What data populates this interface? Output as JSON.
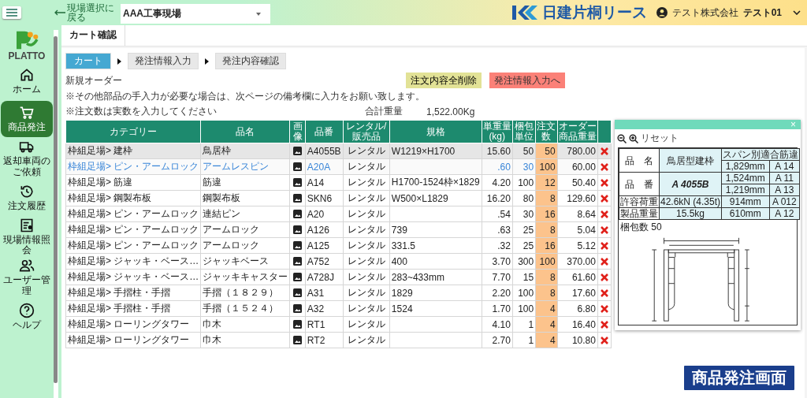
{
  "header": {
    "back_link": "現場選択に戻る",
    "site_select": {
      "value": "AAA工事現場"
    },
    "brand": "日建片桐リース",
    "company": "テスト株式会社",
    "user": "テスト01"
  },
  "sidebar": {
    "logo": "PLATTO",
    "items": [
      {
        "label": "ホーム",
        "selected": false
      },
      {
        "label": "商品発注",
        "selected": true
      },
      {
        "label": "返却車両のご依頼",
        "selected": false
      },
      {
        "label": "注文履歴",
        "selected": false
      },
      {
        "label": "現場情報照会",
        "selected": false
      },
      {
        "label": "ユーザー管理",
        "selected": false
      },
      {
        "label": "ヘルプ",
        "selected": false
      }
    ]
  },
  "page_tab": "カート確認",
  "steps": [
    {
      "label": "カート",
      "selected": true
    },
    {
      "label": "発注情報入力",
      "selected": false
    },
    {
      "label": "発注内容確認",
      "selected": false
    }
  ],
  "order_type": "新規オーダー",
  "buttons": [
    {
      "label": "注文内容全削除",
      "kind": "clear"
    },
    {
      "label": "発注情報入力へ",
      "kind": "next"
    }
  ],
  "notes": [
    "※その他部品の手入力が必要な場合は、次ページの備考欄に入力をお願い致します。",
    "※注文数は実数を入力してください"
  ],
  "total_weight": {
    "label": "合計重量",
    "value": "1,522.00Kg"
  },
  "table": {
    "columns": [
      "カテゴリー",
      "品名",
      "画像",
      "品番",
      "レンタル/販売品",
      "規格",
      "単重量(kg)",
      "梱包単位",
      "注文数",
      "オーダー商品重量"
    ],
    "rows": [
      {
        "selected": true,
        "hover": false,
        "cells": [
          "枠組足場> 建枠",
          "鳥居枠",
          "",
          "A4055B",
          "レンタル",
          "W1219×H1700",
          "15.60",
          "50",
          "50",
          "780.00"
        ]
      },
      {
        "selected": false,
        "hover": true,
        "cells": [
          "枠組足場> ピン・アームロック",
          "アームレスピン",
          "",
          "A20A",
          "レンタル",
          "",
          ".60",
          "30",
          "100",
          "60.00"
        ]
      },
      {
        "selected": false,
        "hover": false,
        "cells": [
          "枠組足場> 筋違",
          "筋違",
          "",
          "A14",
          "レンタル",
          "H1700-1524枠×1829",
          "4.20",
          "100",
          "12",
          "50.40"
        ]
      },
      {
        "selected": false,
        "hover": false,
        "cells": [
          "枠組足場> 鋼製布板",
          "鋼製布板",
          "",
          "SKN6",
          "レンタル",
          "W500×L1829",
          "16.20",
          "80",
          "8",
          "129.60"
        ]
      },
      {
        "selected": false,
        "hover": false,
        "cells": [
          "枠組足場> ピン・アームロック",
          "連結ピン",
          "",
          "A20",
          "レンタル",
          "",
          ".54",
          "30",
          "16",
          "8.64"
        ]
      },
      {
        "selected": false,
        "hover": false,
        "cells": [
          "枠組足場> ピン・アームロック",
          "アームロック",
          "",
          "A126",
          "レンタル",
          "739",
          ".63",
          "25",
          "8",
          "5.04"
        ]
      },
      {
        "selected": false,
        "hover": false,
        "cells": [
          "枠組足場> ピン・アームロック",
          "アームロック",
          "",
          "A125",
          "レンタル",
          "331.5",
          ".32",
          "25",
          "16",
          "5.12"
        ]
      },
      {
        "selected": false,
        "hover": false,
        "cells": [
          "枠組足場> ジャッキ・ベース…",
          "ジャッキベース",
          "",
          "A752",
          "レンタル",
          "400",
          "3.70",
          "300",
          "100",
          "370.00"
        ]
      },
      {
        "selected": false,
        "hover": false,
        "cells": [
          "枠組足場> ジャッキ・ベース…",
          "ジャッキキャスター",
          "",
          "A728J",
          "レンタル",
          "283~433mm",
          "7.70",
          "15",
          "8",
          "61.60"
        ]
      },
      {
        "selected": false,
        "hover": false,
        "cells": [
          "枠組足場> 手摺柱・手摺",
          "手摺（１８２９）",
          "",
          "A31",
          "レンタル",
          "1829",
          "2.20",
          "100",
          "8",
          "17.60"
        ]
      },
      {
        "selected": false,
        "hover": false,
        "cells": [
          "枠組足場> 手摺柱・手摺",
          "手摺（１５２４）",
          "",
          "A32",
          "レンタル",
          "1524",
          "1.70",
          "100",
          "4",
          "6.80"
        ]
      },
      {
        "selected": false,
        "hover": false,
        "cells": [
          "枠組足場> ローリングタワー",
          "巾木",
          "",
          "RT1",
          "レンタル",
          "",
          "4.10",
          "1",
          "4",
          "16.40"
        ]
      },
      {
        "selected": false,
        "hover": false,
        "cells": [
          "枠組足場> ローリングタワー",
          "巾木",
          "",
          "RT2",
          "レンタル",
          "",
          "2.70",
          "1",
          "4",
          "10.80"
        ]
      }
    ]
  },
  "popup": {
    "close": "×",
    "reset": "リセット",
    "spec_sheet": {
      "specs": [
        {
          "label": "品　名",
          "value": "鳥居型建枠"
        },
        {
          "label": "品　番",
          "value": "A 4055B"
        },
        {
          "label": "許容荷重",
          "value": "42.6kN (4.35t)"
        },
        {
          "label": "製品重量",
          "value": "15.5kg"
        }
      ],
      "span_title": "スパン別適合筋違",
      "spans": [
        [
          "1,829mm",
          "A 14"
        ],
        [
          "1,524mm",
          "A 11"
        ],
        [
          "1,219mm",
          "A 13"
        ],
        [
          "914mm",
          "A 012"
        ],
        [
          "610mm",
          "A 12"
        ]
      ],
      "pack_count": "梱包数 50"
    }
  },
  "caption": "商品発注画面"
}
